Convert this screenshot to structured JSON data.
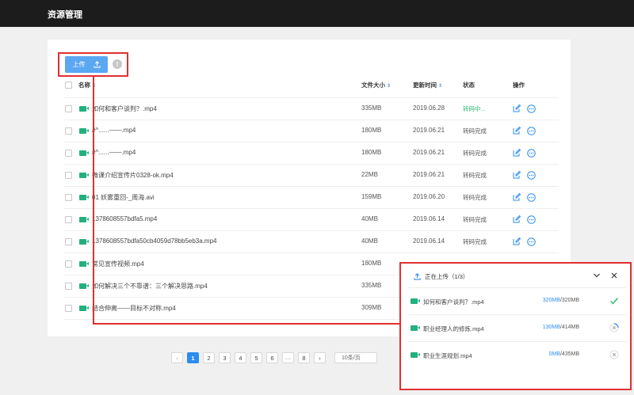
{
  "app": {
    "title": "资源管理"
  },
  "toolbar": {
    "upload_label": "上传",
    "help_glyph": "!"
  },
  "table": {
    "headers": {
      "name": "名称",
      "size": "文件大小",
      "updated": "更新时间",
      "status": "状态",
      "actions": "操作"
    },
    "rows": [
      {
        "name": "如何和客户谈判？.mp4",
        "size": "335MB",
        "date": "2019.06.28",
        "status": "转码中..."
      },
      {
        "name": "#^......——.mp4",
        "size": "180MB",
        "date": "2019.06.21",
        "status": "转码完成"
      },
      {
        "name": "#^......——.mp4",
        "size": "180MB",
        "date": "2019.06.21",
        "status": "转码完成"
      },
      {
        "name": "微课介绍宣传片0328-ok.mp4",
        "size": "22MB",
        "date": "2019.06.21",
        "status": "转码完成"
      },
      {
        "name": "01 妖雾重回-_周海.avi",
        "size": "159MB",
        "date": "2019.06.20",
        "status": "转码完成"
      },
      {
        "name": "1378608557bdfa5.mp4",
        "size": "40MB",
        "date": "2019.06.14",
        "status": "转码完成"
      },
      {
        "name": "1378608557bdfa50cb4059d78bb5eb3a.mp4",
        "size": "40MB",
        "date": "2019.06.14",
        "status": "转码完成"
      },
      {
        "name": "常见宣传视频.mp4",
        "size": "180MB",
        "date": "",
        "status": ""
      },
      {
        "name": "如何解决三个不靠谱：三个解决思路.mp4",
        "size": "335MB",
        "date": "",
        "status": ""
      },
      {
        "name": "结合伸离——目标不对称.mp4",
        "size": "309MB",
        "date": "",
        "status": ""
      }
    ]
  },
  "pagination": {
    "pages": [
      "1",
      "2",
      "3",
      "4",
      "5",
      "6",
      "···",
      "8"
    ],
    "active": "1",
    "prev": "‹",
    "next": "›",
    "page_size": "10条/页"
  },
  "upload_panel": {
    "title": "正在上传（1/3）",
    "items": [
      {
        "name": "如何和客户谈判？.mp4",
        "done": "320MB",
        "total": "/320MB",
        "state": "complete"
      },
      {
        "name": "职业经理人的修炼.mp4",
        "done": "130MB",
        "total": "/414MB",
        "state": "uploading"
      },
      {
        "name": "职业生涯规划.mp4",
        "done": "0MB",
        "total": "/435MB",
        "state": "waiting"
      }
    ]
  },
  "colors": {
    "accent": "#2d8cf0",
    "success": "#2bb673",
    "file_icon": "#22b07c",
    "highlight": "#e03030"
  }
}
